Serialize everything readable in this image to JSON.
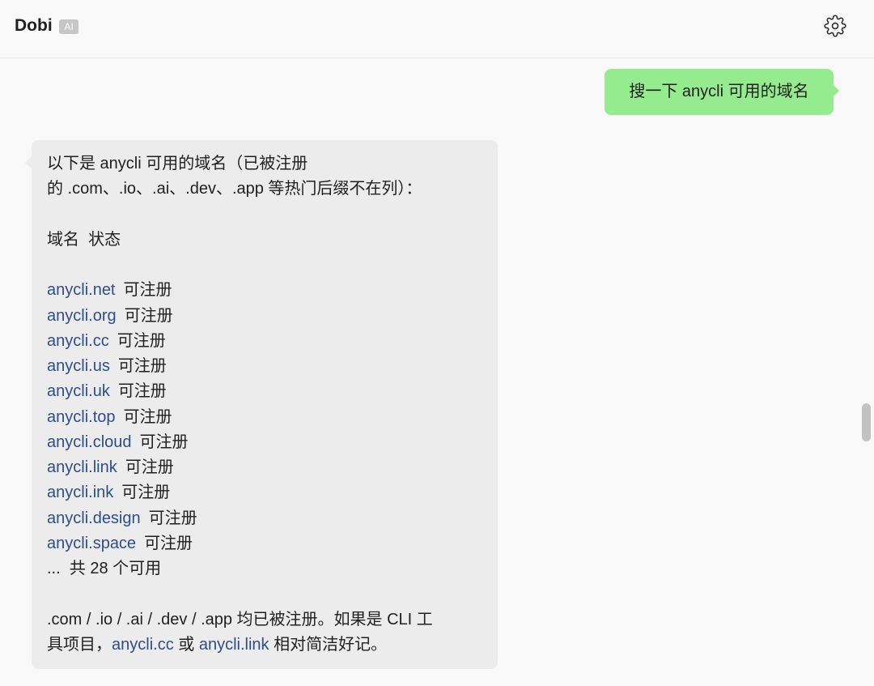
{
  "header": {
    "title": "Dobi",
    "badge": "AI",
    "settings_icon": "gear-icon"
  },
  "user_message": {
    "text": "搜一下 anycli 可用的域名",
    "color": "#95ec8e"
  },
  "bot_message": {
    "intro_line1": "以下是 anycli 可用的域名（已被注册",
    "intro_line2": "的 .com、.io、.ai、.dev、.app 等热门后缀不在列）：",
    "table_header": "域名  状态",
    "domains": [
      {
        "name": "anycli.net",
        "status": "可注册"
      },
      {
        "name": "anycli.org",
        "status": "可注册"
      },
      {
        "name": "anycli.cc",
        "status": "可注册"
      },
      {
        "name": "anycli.us",
        "status": "可注册"
      },
      {
        "name": "anycli.uk",
        "status": "可注册"
      },
      {
        "name": "anycli.top",
        "status": "可注册"
      },
      {
        "name": "anycli.cloud",
        "status": "可注册"
      },
      {
        "name": "anycli.link",
        "status": "可注册"
      },
      {
        "name": "anycli.ink",
        "status": "可注册"
      },
      {
        "name": "anycli.design",
        "status": "可注册"
      },
      {
        "name": "anycli.space",
        "status": "可注册"
      }
    ],
    "summary": "...  共 28 个可用",
    "footer_line1": ".com / .io / .ai / .dev / .app 均已被注册。如果是 CLI 工",
    "footer_prefix": "具项目，",
    "footer_link1": "anycli.cc",
    "footer_or": " 或 ",
    "footer_link2": "anycli.link",
    "footer_suffix": " 相对简洁好记。",
    "link_color": "#2f4d8a",
    "bubble_color": "#ececec"
  }
}
